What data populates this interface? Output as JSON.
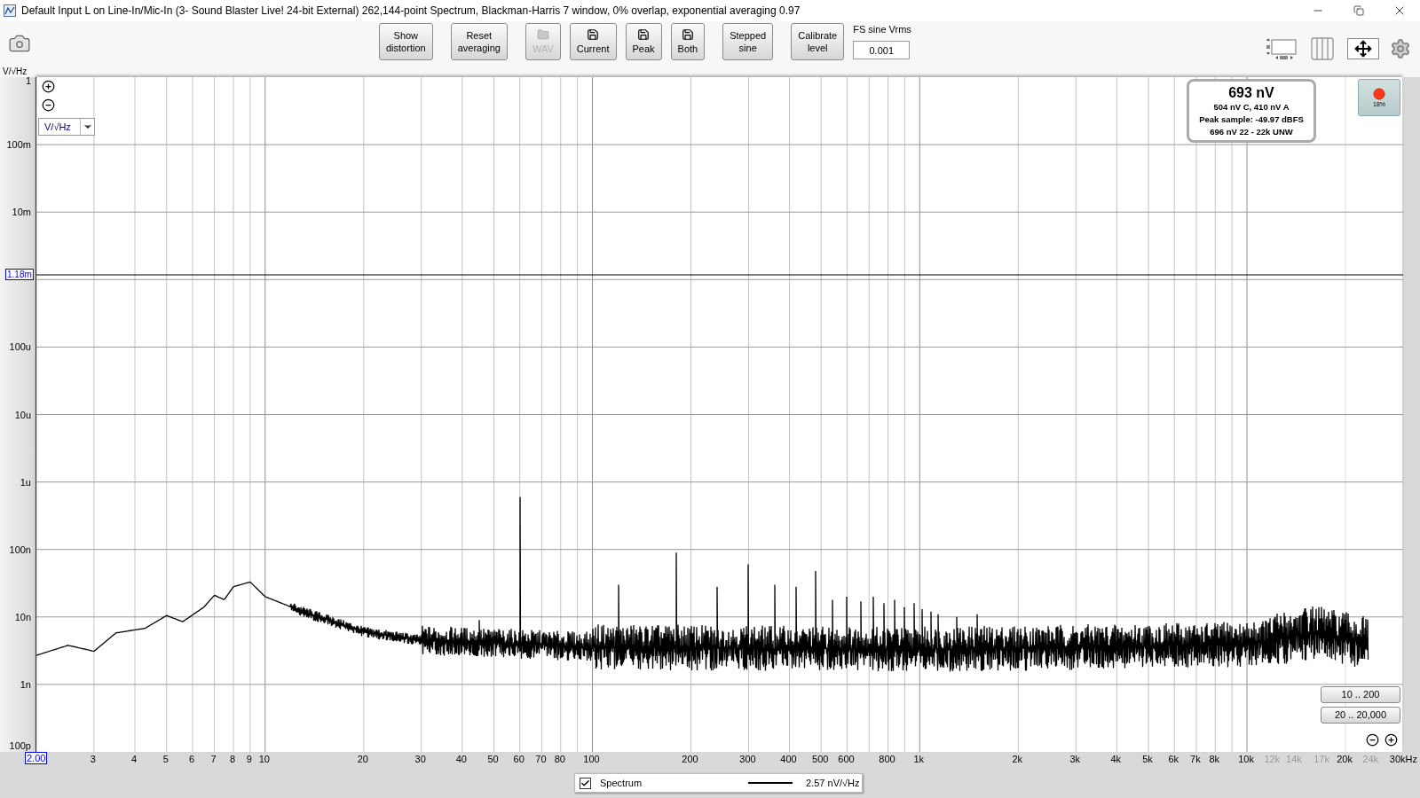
{
  "window": {
    "title": "Default Input L on Line-In/Mic-In (3- Sound Blaster Live! 24-bit External) 262,144-point Spectrum, Blackman-Harris 7 window, 0% overlap, exponential averaging 0.97"
  },
  "toolbar": {
    "buttons": [
      {
        "kind": "text",
        "lines": [
          "Show",
          "distortion"
        ],
        "disabled": false
      },
      {
        "kind": "text",
        "lines": [
          "Reset",
          "averaging"
        ],
        "disabled": false
      },
      {
        "kind": "folder",
        "lines": [
          "WAV"
        ],
        "disabled": true
      },
      {
        "kind": "save",
        "lines": [
          "Current"
        ],
        "disabled": false
      },
      {
        "kind": "save",
        "lines": [
          "Peak"
        ],
        "disabled": false
      },
      {
        "kind": "save",
        "lines": [
          "Both"
        ],
        "disabled": false
      },
      {
        "kind": "text",
        "lines": [
          "Stepped",
          "sine"
        ],
        "disabled": false
      },
      {
        "kind": "text",
        "lines": [
          "Calibrate",
          "level"
        ],
        "disabled": false
      }
    ],
    "fs_sine": {
      "label": "FS sine Vrms",
      "value": "0.001"
    }
  },
  "y_unit_label": "V/√Hz",
  "plot": {
    "unit_select": "V/√Hz",
    "y_ticks": [
      "1",
      "100m",
      "10m",
      "100u",
      "10u",
      "1u",
      "100n",
      "10n",
      "1n",
      "100p"
    ],
    "y_marker": "1.18m",
    "x_cursor": "2.00",
    "x_ticks": [
      {
        "label": "3",
        "muted": false
      },
      {
        "label": "4",
        "muted": false
      },
      {
        "label": "5",
        "muted": false
      },
      {
        "label": "6",
        "muted": false
      },
      {
        "label": "7",
        "muted": false
      },
      {
        "label": "8",
        "muted": false
      },
      {
        "label": "9",
        "muted": false
      },
      {
        "label": "10",
        "muted": false
      },
      {
        "label": "20",
        "muted": false
      },
      {
        "label": "30",
        "muted": false
      },
      {
        "label": "40",
        "muted": false
      },
      {
        "label": "50",
        "muted": false
      },
      {
        "label": "60",
        "muted": false
      },
      {
        "label": "70",
        "muted": false
      },
      {
        "label": "80",
        "muted": false
      },
      {
        "label": "100",
        "muted": false
      },
      {
        "label": "200",
        "muted": false
      },
      {
        "label": "300",
        "muted": false
      },
      {
        "label": "400",
        "muted": false
      },
      {
        "label": "500",
        "muted": false
      },
      {
        "label": "600",
        "muted": false
      },
      {
        "label": "800",
        "muted": false
      },
      {
        "label": "1k",
        "muted": false
      },
      {
        "label": "2k",
        "muted": false
      },
      {
        "label": "3k",
        "muted": false
      },
      {
        "label": "4k",
        "muted": false
      },
      {
        "label": "5k",
        "muted": false
      },
      {
        "label": "6k",
        "muted": false
      },
      {
        "label": "7k",
        "muted": false
      },
      {
        "label": "8k",
        "muted": false
      },
      {
        "label": "10k",
        "muted": false
      },
      {
        "label": "12k",
        "muted": true
      },
      {
        "label": "14k",
        "muted": true
      },
      {
        "label": "17k",
        "muted": true
      },
      {
        "label": "20k",
        "muted": false
      },
      {
        "label": "24k",
        "muted": true
      },
      {
        "label": "30kHz",
        "muted": false
      }
    ],
    "readout": {
      "value": "693 nV",
      "lines": [
        "504 nV C, 410 nV A",
        "Peak sample: -49.97 dBFS",
        "696 nV 22 - 22k UNW"
      ]
    },
    "record_button": {
      "label": "18%"
    },
    "range_buttons": [
      "10 .. 200",
      "20 .. 20,000"
    ]
  },
  "legend": {
    "checked": true,
    "name": "Spectrum",
    "reading": "2.57 nV/√Hz"
  }
}
